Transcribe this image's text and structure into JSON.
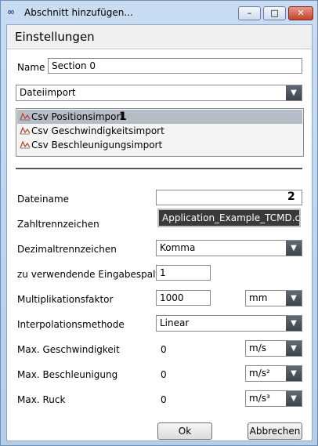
{
  "window": {
    "title": "Abschnitt hinzufügen...",
    "icon": "infinity-icon",
    "controls": {
      "minimize": "–",
      "maximize": "□",
      "close": "✕"
    }
  },
  "section_title": "Einstellungen",
  "name": {
    "label": "Name",
    "value": "Section 0"
  },
  "import_type": {
    "selected": "Dateiimport"
  },
  "import_list": {
    "items": [
      {
        "label": "Csv Positionsimport",
        "selected": true,
        "badge": "1"
      },
      {
        "label": "Csv Geschwindigkeitsimport",
        "selected": false
      },
      {
        "label": "Csv Beschleunigungsimport",
        "selected": false
      }
    ]
  },
  "file": {
    "label": "Dateiname",
    "value": "",
    "badge": "2",
    "tooltip": "Application_Example_TCMD.csv"
  },
  "number_separator": {
    "label": "Zahltrennzeichen"
  },
  "decimal_separator": {
    "label": "Dezimaltrennzeichen",
    "selected": "Komma"
  },
  "input_column": {
    "label": "zu verwendende Eingabespalte",
    "value": "1"
  },
  "multiplier": {
    "label": "Multiplikationsfaktor",
    "value": "1000",
    "unit": "mm"
  },
  "interpolation": {
    "label": "Interpolationsmethode",
    "selected": "Linear"
  },
  "max_velocity": {
    "label": "Max. Geschwindigkeit",
    "value": "0",
    "unit": "m/s"
  },
  "max_acceleration": {
    "label": "Max. Beschleunigung",
    "value": "0",
    "unit": "m/s²"
  },
  "max_jerk": {
    "label": "Max. Ruck",
    "value": "0",
    "unit": "m/s³"
  },
  "buttons": {
    "ok": "Ok",
    "cancel": "Abbrechen"
  }
}
